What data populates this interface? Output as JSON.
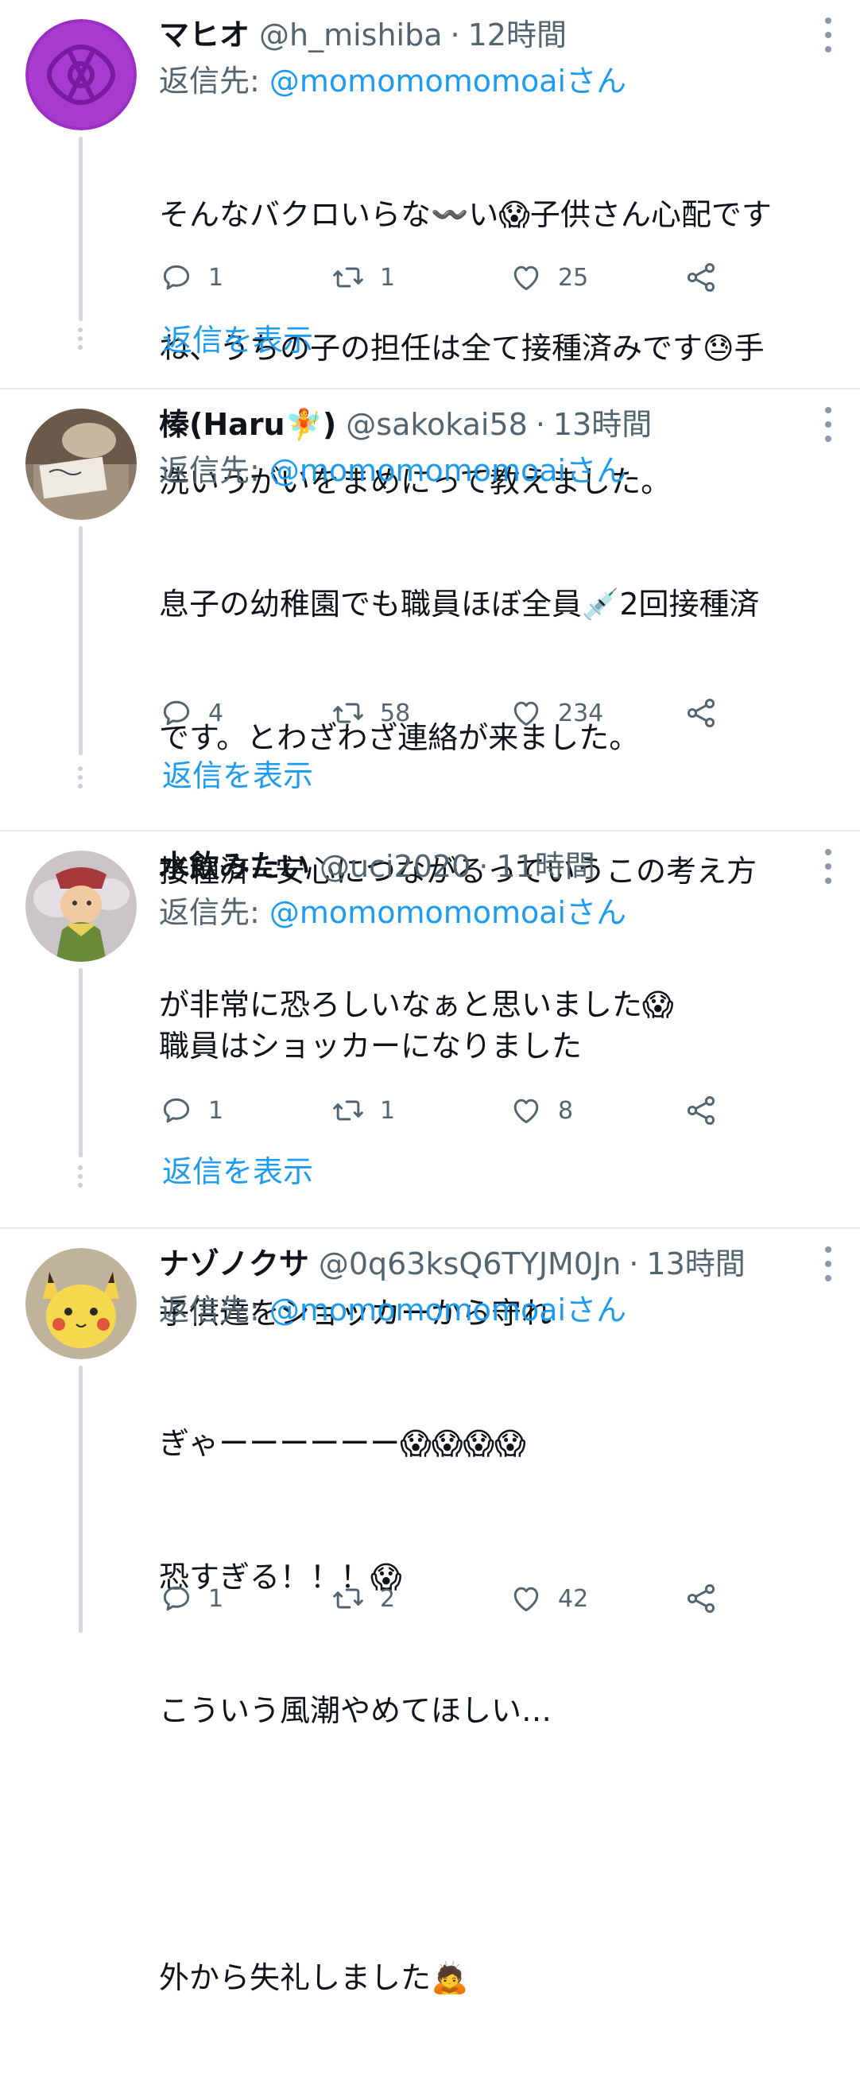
{
  "tweets": [
    {
      "name": "マヒオ",
      "handle": "@h_mishiba",
      "separator": "·",
      "time": "12時間",
      "reply_prefix": "返信先:",
      "reply_to": "@momomomomoaiさん",
      "lines": [
        "そんなバクロいらな〰️い😱子供さん心配です",
        "ね、うちの子の担任は全て接種済みです😓手",
        "洗いうがいをまめにって教えました。"
      ],
      "replies": "1",
      "retweets": "1",
      "likes": "25",
      "show_replies": "返信を表示"
    },
    {
      "name": "榛(Haru🧚)",
      "handle": "@sakokai58",
      "separator": "·",
      "time": "13時間",
      "reply_prefix": "返信先:",
      "reply_to": "@momomomomoaiさん",
      "lines": [
        "息子の幼稚園でも職員ほぼ全員💉2回接種済",
        "です。とわざわざ連絡が来ました。",
        "接種済=安心につながるっていうこの考え方",
        "が非常に恐ろしいなぁと思いました😱"
      ],
      "replies": "4",
      "retweets": "58",
      "likes": "234",
      "show_replies": "返信を表示"
    },
    {
      "name": "水飲みたい",
      "handle": "@uci2020",
      "separator": "·",
      "time": "11時間",
      "reply_prefix": "返信先:",
      "reply_to": "@momomomomoaiさん",
      "lines": [
        "職員はショッカーになりました",
        "",
        "子供達をショッカーから守れ"
      ],
      "replies": "1",
      "retweets": "1",
      "likes": "8",
      "show_replies": "返信を表示"
    },
    {
      "name": "ナゾノクサ",
      "handle": "@0q63ksQ6TYJM0Jn",
      "separator": "·",
      "time": "13時間",
      "reply_prefix": "返信先:",
      "reply_to": "@momomomomoaiさん",
      "lines": [
        "ぎゃーーーーーー😱😱😱😱",
        "恐すぎる！！！😱",
        "こういう風潮やめてほしい…",
        "",
        "外から失礼しました🙇"
      ],
      "replies": "1",
      "retweets": "2",
      "likes": "42"
    }
  ],
  "icons": {
    "reply": "reply-icon",
    "retweet": "retweet-icon",
    "like": "like-icon",
    "share": "share-icon",
    "more": "more-icon"
  },
  "colors": {
    "link": "#1d9bf0",
    "secondary_text": "#536471",
    "divider": "#e5e8eb"
  }
}
